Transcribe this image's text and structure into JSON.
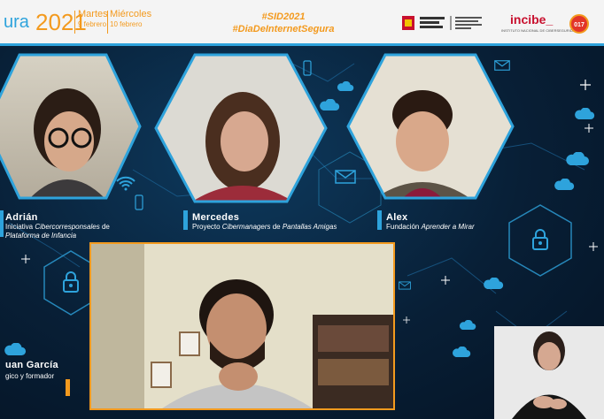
{
  "header": {
    "brand_fragment": "ura",
    "year": "2021",
    "day1": {
      "name": "Martes",
      "date": "9 febrero"
    },
    "day2": {
      "name": "Miércoles",
      "date": "10 febrero"
    },
    "hashtag1": "#SID2021",
    "hashtag2": "#DiaDeInternetSegura",
    "incibe_label": "incibe_",
    "incibe_subtitle": "INSTITUTO NACIONAL DE CIBERSEGURIDAD",
    "helpline_badge": "017"
  },
  "participants": [
    {
      "name": "Adrián",
      "line1_plain": "Iniciativa ",
      "line1_em": "Cibercorresponsales",
      "line1_tail": " de",
      "line2_em": "Plataforma de Infancia"
    },
    {
      "name": "Mercedes",
      "line1_plain": "Proyecto ",
      "line1_em": "Cibermanagers",
      "line1_tail": " de ",
      "line1_em2": "Pantallas Amigas"
    },
    {
      "name": "Alex",
      "line1_plain": "Fundación ",
      "line1_em": "Aprender a Mirar"
    }
  ],
  "main_speaker": {
    "name_fragment": "uan García",
    "role_fragment": "gico y formador"
  },
  "colors": {
    "accent_blue": "#2ea3dc",
    "accent_orange": "#f39a1e",
    "background": "#07213a"
  },
  "icons": [
    "cloud-icon",
    "padlock-icon",
    "envelope-icon",
    "wifi-icon",
    "smartphone-icon",
    "sparkle-icon"
  ]
}
